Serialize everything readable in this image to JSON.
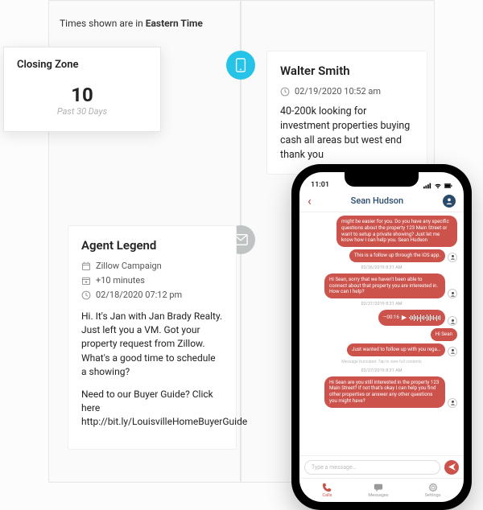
{
  "timezone_note_prefix": "Times shown are in ",
  "timezone_note_bold": "Eastern Time",
  "closing": {
    "title": "Closing Zone",
    "value": "10",
    "sub": "Past 30 Days"
  },
  "walter": {
    "name": "Walter Smith",
    "time": "02/19/2020 10:52 am",
    "body": "40-200k looking for investment properties buying cash all areas but west end thank you"
  },
  "legend": {
    "title": "Agent Legend",
    "campaign": "Zillow Campaign",
    "delta": "+10 minutes",
    "time": "02/18/2020 07:12 pm",
    "body1": "Hi. It's Jan with Jan Brady Realty. Just left you a VM. Got your property request from Zillow. What's a good time to schedule a showing?",
    "body2": "Need to our Buyer Guide? Click here http://bit.ly/LouisvilleHomeBuyerGuide"
  },
  "phone": {
    "status_time": "11:01",
    "contact_name": "Sean Hudson",
    "messages": {
      "m1": "might be easier for you. Do you have any specific questions about the property 123 Main Street or want to setup a private showing? Just let me know how I can help you. Sean Hudson",
      "m2": "This is a follow up through the iOS app.",
      "d1": "02/26/2019 8:31 AM",
      "m3": "Hi Sean, sorry that we haven't been able to connect about that property you are interested in. How can I help?",
      "d2": "02/27/2019 8:31 AM",
      "wave_time": "—00:16",
      "m4": "Hi Sean",
      "m5": "Just wanted to follow up with you rega…",
      "trunc": "Message truncated. Tap to view full contents",
      "d3": "02/27/2019 8:31 AM",
      "m6": "Hi Sean are you still interested in the property 123 Main Street? If not that's okay I can help you find other properties or answer any other questions you might have?"
    },
    "composer_placeholder": "Type a message…",
    "tabs": {
      "calls": "Calls",
      "messages": "Messages",
      "settings": "Settings"
    }
  }
}
